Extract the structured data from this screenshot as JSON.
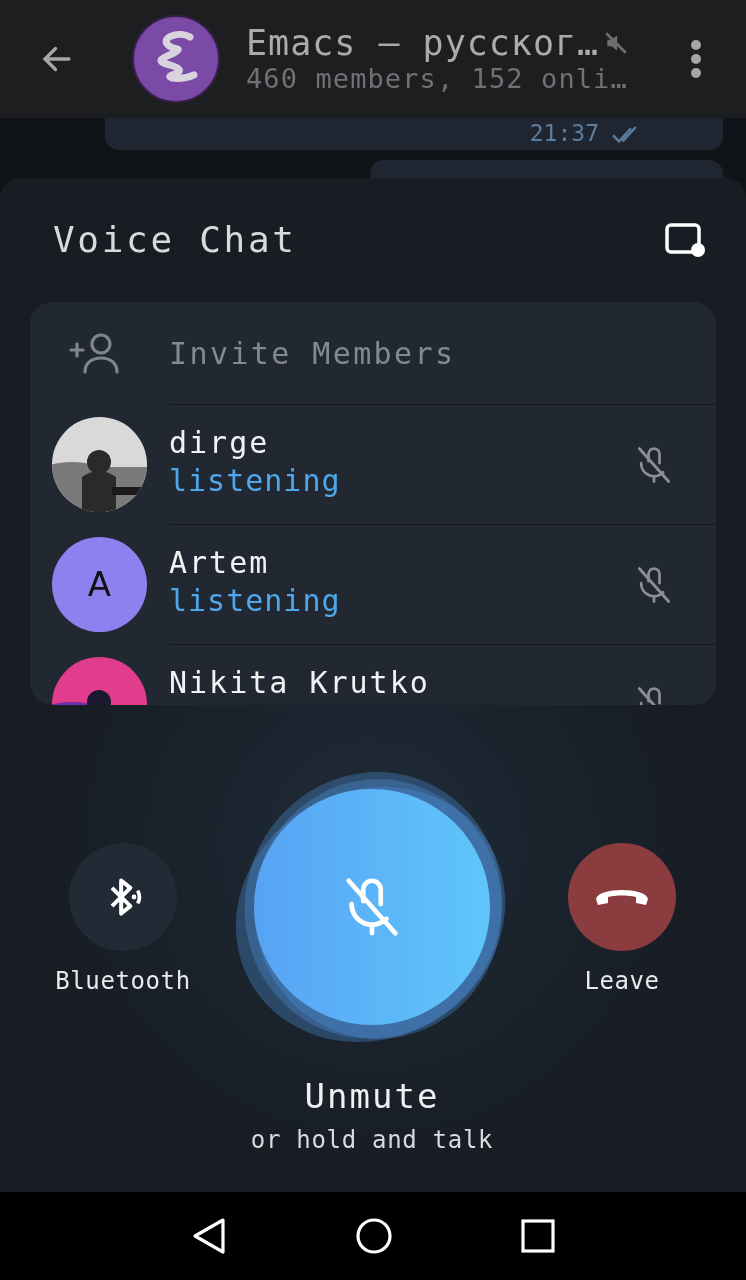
{
  "chat": {
    "title": "Emacs — русског…",
    "subtitle": "460 members, 152 onli…",
    "muted": true
  },
  "message": {
    "time": "21:37",
    "read": true
  },
  "voice_chat": {
    "title": "Voice Chat",
    "invite": "Invite Members",
    "members": [
      {
        "name": "dirge",
        "status": "listening",
        "muted": true
      },
      {
        "name": "Artem",
        "status": "listening",
        "kind": "letter",
        "initial": "A",
        "color": "#8e80ee",
        "muted": true
      },
      {
        "name": "Nikita Krutko",
        "muted": true
      }
    ]
  },
  "controls": [
    {
      "kind": "bluetooth",
      "label": "Bluetooth"
    },
    {
      "kind": "leave",
      "label": "Leave"
    }
  ],
  "mic": {
    "muted": true,
    "label": "Unmute",
    "hint": "or hold and talk"
  }
}
